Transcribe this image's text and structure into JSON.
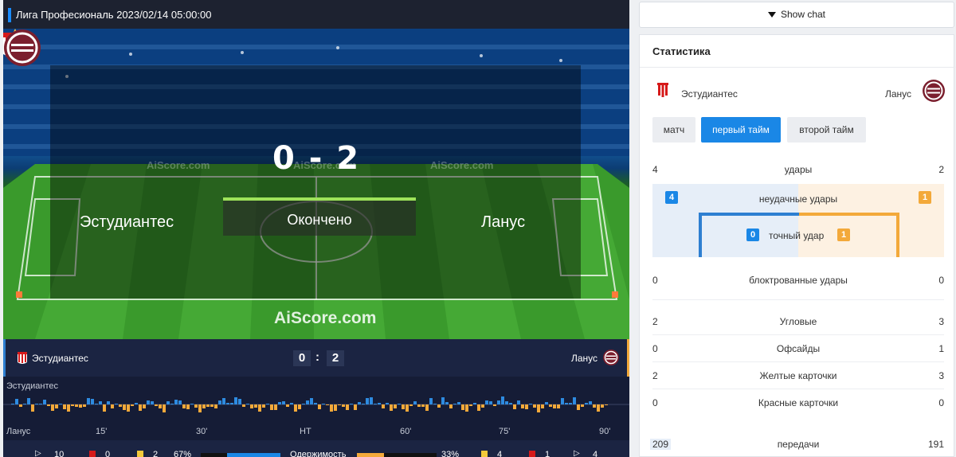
{
  "header": {
    "title": "Лига Професиональ 2023/02/14 05:00:00"
  },
  "match": {
    "home": "Эстудиантес",
    "away": "Ланус",
    "score_display": "0 - 2",
    "home_score": "0",
    "away_score": "2",
    "score_sep": ":",
    "status": "Окончено",
    "watermark": "AiScore.com",
    "brand": "AiScore.com"
  },
  "momentum": {
    "home_label": "Эстудиантес",
    "away_label": "Ланус",
    "ticks": [
      "15'",
      "30'",
      "HT",
      "60'",
      "75'",
      "90'"
    ]
  },
  "bottom_stats": {
    "home_shots": "10",
    "home_red": "0",
    "home_yellow": "2",
    "home_possession": "67%",
    "possession_label": "Одержимость",
    "away_possession": "33%",
    "away_yellow": "4",
    "away_red": "1",
    "away_shots": "4",
    "possession_home_value": 67,
    "possession_away_value": 33
  },
  "chat": {
    "label": "Show chat"
  },
  "stats": {
    "title": "Статистика",
    "home_team": "Эстудиантес",
    "away_team": "Ланус",
    "tabs": [
      {
        "label": "матч",
        "active": false
      },
      {
        "label": "первый тайм",
        "active": true
      },
      {
        "label": "второй тайм",
        "active": false
      }
    ],
    "rows": [
      {
        "label": "удары",
        "home": "4",
        "away": "2"
      },
      {
        "label": "блоктрованные удары",
        "home": "0",
        "away": "0"
      },
      {
        "label": "Угловые",
        "home": "2",
        "away": "3"
      },
      {
        "label": "Офсайды",
        "home": "0",
        "away": "1"
      },
      {
        "label": "Желтые карточки",
        "home": "2",
        "away": "3"
      },
      {
        "label": "Красные карточки",
        "home": "0",
        "away": "0"
      },
      {
        "label": "передачи",
        "home": "209",
        "away": "191"
      }
    ],
    "missed": {
      "label": "неудачные удары",
      "home": "4",
      "away": "1"
    },
    "on_target": {
      "label": "точный удар",
      "home": "0",
      "away": "1"
    }
  },
  "colors": {
    "home": "#2e7fd1",
    "away": "#f3a93a",
    "accent": "#1a87e6"
  }
}
